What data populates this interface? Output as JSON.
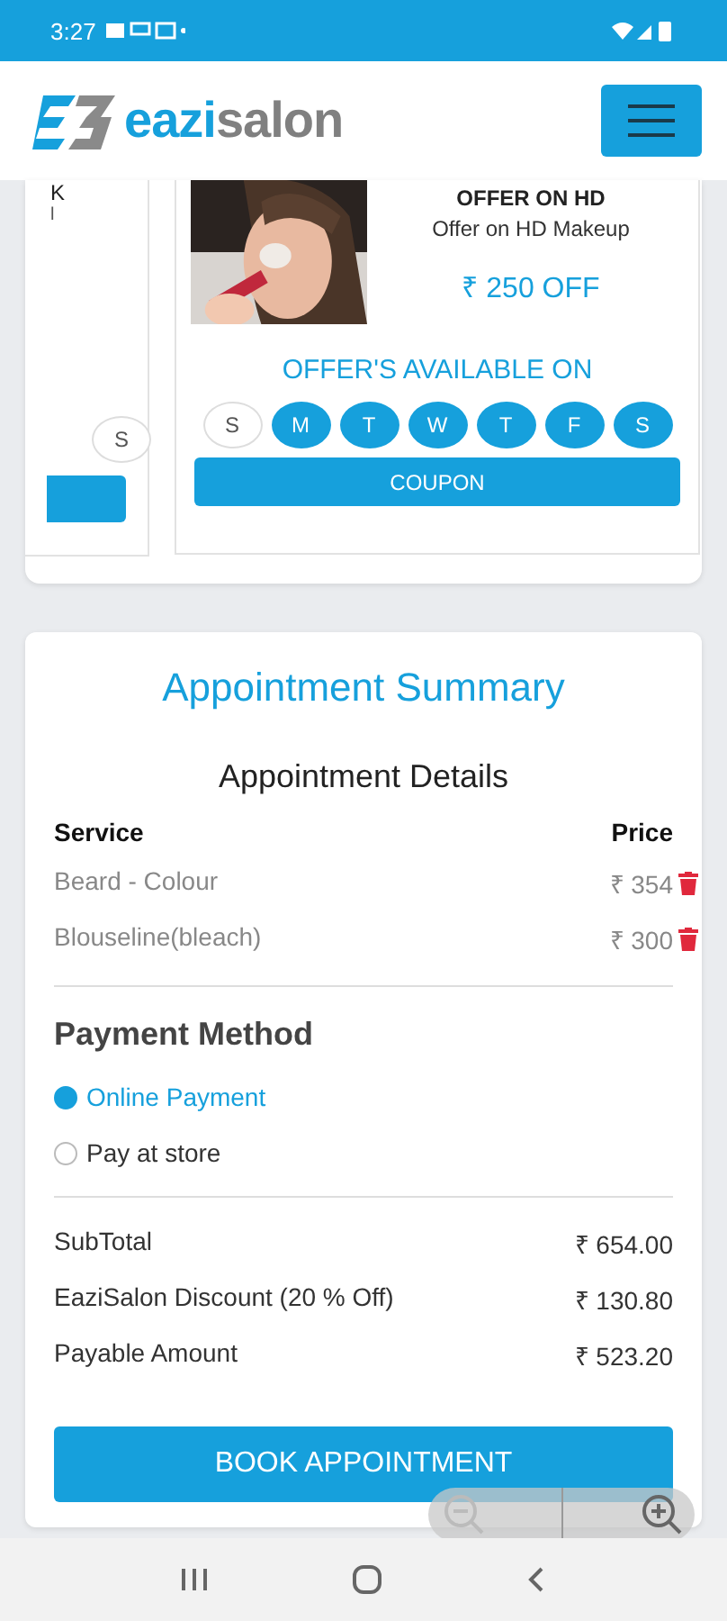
{
  "status_bar": {
    "time": "3:27"
  },
  "header": {
    "brand_first": "eazi",
    "brand_second": "salon"
  },
  "offers": {
    "left_card": {
      "title": "K",
      "subtitle": "l",
      "days": [
        {
          "label": "S",
          "selected": false
        }
      ]
    },
    "card": {
      "title": "OFFER ON HD",
      "subtitle": "Offer on HD Makeup",
      "discount": "₹ 250 OFF",
      "available_label": "OFFER'S AVAILABLE ON",
      "days": [
        {
          "label": "S",
          "selected": false
        },
        {
          "label": "M",
          "selected": true
        },
        {
          "label": "T",
          "selected": true
        },
        {
          "label": "W",
          "selected": true
        },
        {
          "label": "T",
          "selected": true
        },
        {
          "label": "F",
          "selected": true
        },
        {
          "label": "S",
          "selected": true
        }
      ],
      "button": "COUPON"
    }
  },
  "summary": {
    "title": "Appointment Summary",
    "details_title": "Appointment Details",
    "columns": [
      "Service",
      "Price"
    ],
    "rows": [
      {
        "service": "Beard - Colour",
        "price": "₹ 354"
      },
      {
        "service": "Blouseline(bleach)",
        "price": "₹ 300"
      }
    ],
    "payment_title": "Payment Method",
    "payment_options": [
      {
        "label": "Online Payment",
        "selected": true
      },
      {
        "label": "Pay at store",
        "selected": false
      }
    ],
    "totals": [
      {
        "label": "SubTotal",
        "value": "₹ 654.00"
      },
      {
        "label": "EaziSalon Discount (20 % Off)",
        "value": "₹ 130.80"
      },
      {
        "label": "Payable Amount",
        "value": "₹ 523.20"
      }
    ],
    "button": "BOOK APPOINTMENT"
  }
}
